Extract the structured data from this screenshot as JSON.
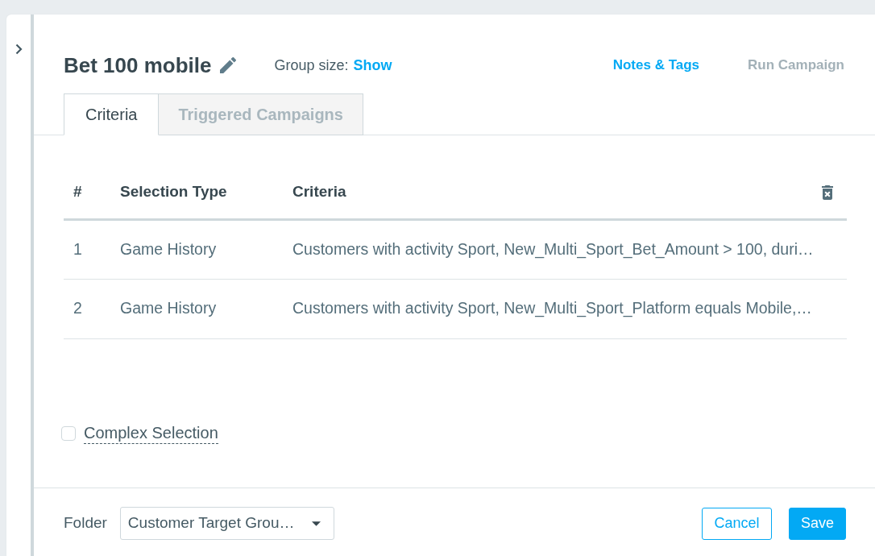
{
  "header": {
    "title": "Bet 100 mobile",
    "group_size": {
      "label": "Group size:",
      "link": "Show"
    },
    "actions": [
      {
        "label": "Notes & Tags",
        "disabled": false
      },
      {
        "label": "Run Campaign",
        "disabled": true
      }
    ]
  },
  "tabs": [
    {
      "label": "Criteria",
      "selected": true
    },
    {
      "label": "Triggered Campaigns",
      "selected": false
    }
  ],
  "table": {
    "columns": [
      "#",
      "Selection Type",
      "Criteria"
    ],
    "rows": [
      {
        "cells": [
          "1",
          "Game History",
          "Customers with activity Sport, New_Multi_Sport_Bet_Amount > 100, duri…"
        ]
      },
      {
        "cells": [
          "2",
          "Game History",
          "Customers with activity Sport, New_Multi_Sport_Platform equals Mobile,…"
        ]
      }
    ]
  },
  "complex_selection": {
    "label": "Complex Selection",
    "checked": false
  },
  "footer": {
    "folder": {
      "label": "Folder",
      "value": "Customer Target Grou…"
    },
    "buttons": [
      {
        "label": "Cancel",
        "kind": "outline"
      },
      {
        "label": "Save",
        "kind": "primary"
      }
    ]
  }
}
